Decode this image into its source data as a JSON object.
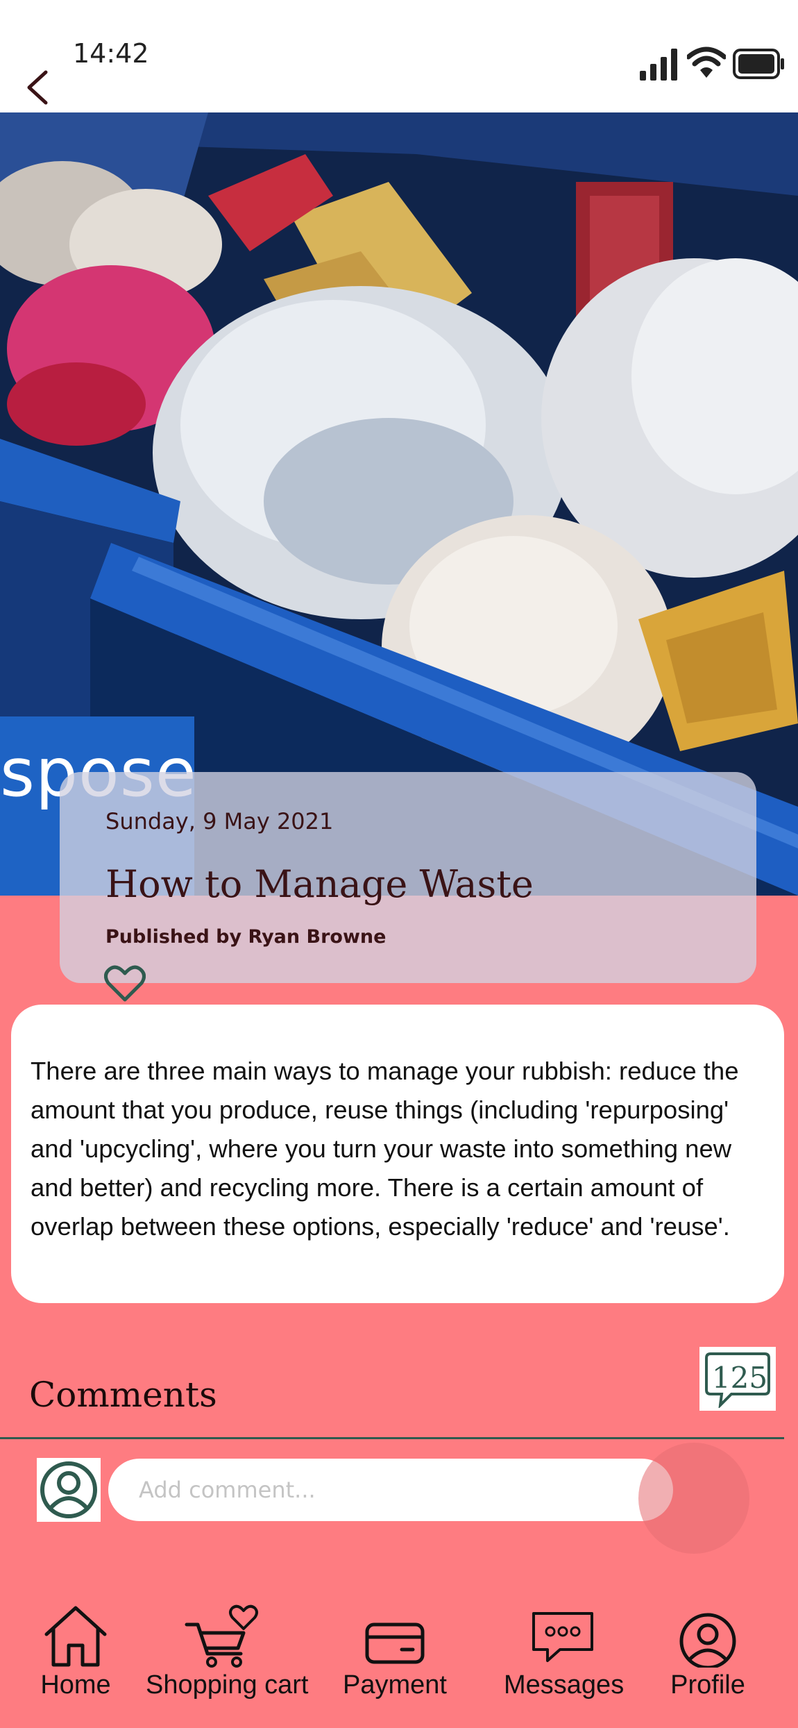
{
  "status_bar": {
    "time": "14:42"
  },
  "hero": {
    "image_text": "spose"
  },
  "article": {
    "date": "Sunday, 9 May 2021",
    "title": "How to Manage Waste",
    "author": "Published by Ryan Browne",
    "body": "There are three main ways to manage your rubbish: reduce the amount that you produce, reuse things (including 'repurposing' and 'upcycling', where you turn your waste into something new and better) and recycling more. There is a certain amount of overlap between these options, especially 'reduce' and 'reuse'."
  },
  "comments": {
    "label": "Comments",
    "count": "125",
    "input_placeholder": "Add comment..."
  },
  "nav": {
    "items": [
      {
        "label": "Home",
        "icon": "home-icon"
      },
      {
        "label": "Shopping cart",
        "icon": "cart-heart-icon"
      },
      {
        "label": "Payment",
        "icon": "card-icon"
      },
      {
        "label": "Messages",
        "icon": "message-icon"
      },
      {
        "label": "Profile",
        "icon": "profile-icon"
      }
    ]
  },
  "colors": {
    "background": "#FE7C81",
    "accent": "#2f5b4f",
    "text_dark": "#3a1316"
  }
}
